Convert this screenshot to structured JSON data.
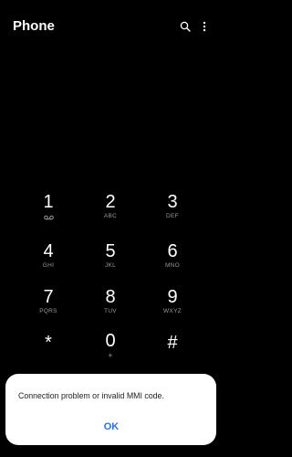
{
  "header": {
    "title": "Phone",
    "search_icon": "search-icon",
    "more_icon": "more-vertical-icon"
  },
  "keypad": {
    "keys": [
      {
        "digit": "1",
        "letters": "voicemail"
      },
      {
        "digit": "2",
        "letters": "ABC"
      },
      {
        "digit": "3",
        "letters": "DEF"
      },
      {
        "digit": "4",
        "letters": "GHI"
      },
      {
        "digit": "5",
        "letters": "JKL"
      },
      {
        "digit": "6",
        "letters": "MNO"
      },
      {
        "digit": "7",
        "letters": "PQRS"
      },
      {
        "digit": "8",
        "letters": "TUV"
      },
      {
        "digit": "9",
        "letters": "WXYZ"
      },
      {
        "digit": "*",
        "letters": ""
      },
      {
        "digit": "0",
        "letters": "+"
      },
      {
        "digit": "#",
        "letters": ""
      }
    ]
  },
  "dialog": {
    "message": "Connection problem or invalid MMI code.",
    "ok_label": "OK"
  },
  "colors": {
    "background": "#000000",
    "dialog_bg": "#ffffff",
    "accent": "#2a73d8",
    "letters": "#9a9a9a"
  }
}
